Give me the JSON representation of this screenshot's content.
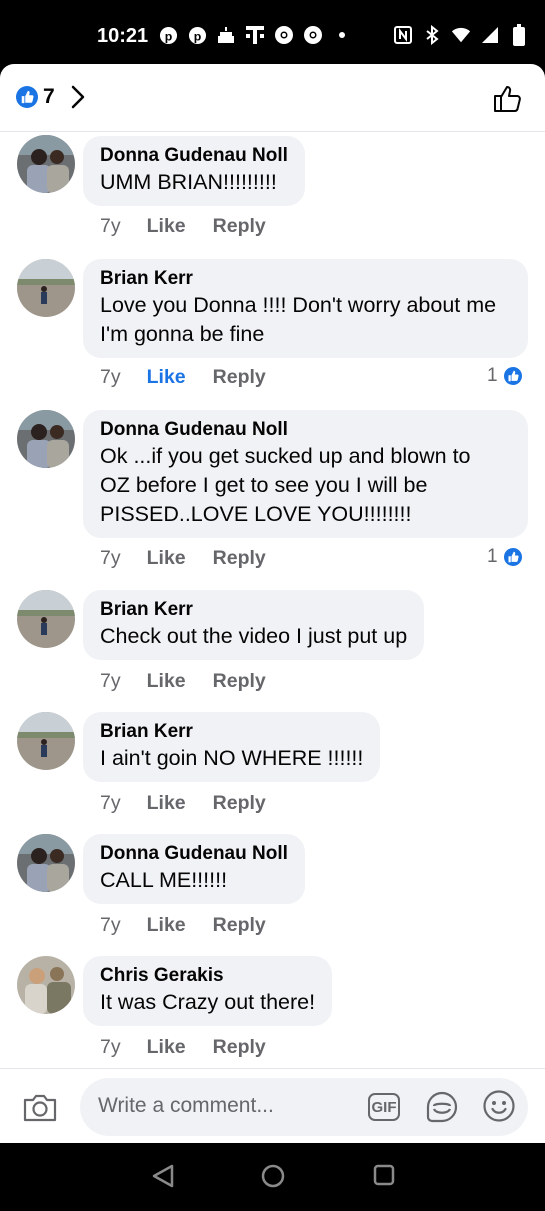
{
  "status_bar": {
    "time": "10:21",
    "left_icons": [
      "pinterest-icon",
      "pinterest-icon",
      "cake-icon",
      "t-mobile-icon",
      "chrome-icon",
      "chrome-icon",
      "dot-icon"
    ],
    "right_icons": [
      "nfc-icon",
      "bluetooth-icon",
      "wifi-icon",
      "signal-icon",
      "battery-icon"
    ]
  },
  "header": {
    "reaction_count": "7",
    "reaction_icon": "like-reaction-icon",
    "like_button_icon": "thumbs-up-outline-icon"
  },
  "comments": [
    {
      "name": "Donna Gudenau Noll",
      "text": [
        "UMM BRIAN!!!!!!!!!"
      ],
      "time": "7y",
      "like": "Like",
      "reply": "Reply",
      "liked": false,
      "reactions": ""
    },
    {
      "name": "Brian Kerr",
      "text": [
        "Love you Donna !!!! Don't worry about me",
        "I'm gonna be fine"
      ],
      "time": "7y",
      "like": "Like",
      "reply": "Reply",
      "liked": true,
      "reactions": "1"
    },
    {
      "name": "Donna Gudenau Noll",
      "text": [
        "Ok ...if you get sucked up and blown to",
        "OZ before I get to see you I will be",
        "PISSED..LOVE LOVE YOU!!!!!!!!"
      ],
      "time": "7y",
      "like": "Like",
      "reply": "Reply",
      "liked": false,
      "reactions": "1"
    },
    {
      "name": "Brian Kerr",
      "text": [
        "Check out the video I just put up"
      ],
      "time": "7y",
      "like": "Like",
      "reply": "Reply",
      "liked": false,
      "reactions": ""
    },
    {
      "name": "Brian Kerr",
      "text": [
        "I ain't goin NO WHERE !!!!!!"
      ],
      "time": "7y",
      "like": "Like",
      "reply": "Reply",
      "liked": false,
      "reactions": ""
    },
    {
      "name": "Donna Gudenau Noll",
      "text": [
        "CALL ME!!!!!!"
      ],
      "time": "7y",
      "like": "Like",
      "reply": "Reply",
      "liked": false,
      "reactions": ""
    },
    {
      "name": "Chris Gerakis",
      "text": [
        "It was Crazy out there!"
      ],
      "time": "7y",
      "like": "Like",
      "reply": "Reply",
      "liked": false,
      "reactions": ""
    }
  ],
  "composer": {
    "placeholder": "Write a comment...",
    "gif_label": "GIF"
  },
  "colors": {
    "accent": "#1b74e4",
    "bubble": "#f0f2f5",
    "secondary_text": "#65676b"
  }
}
